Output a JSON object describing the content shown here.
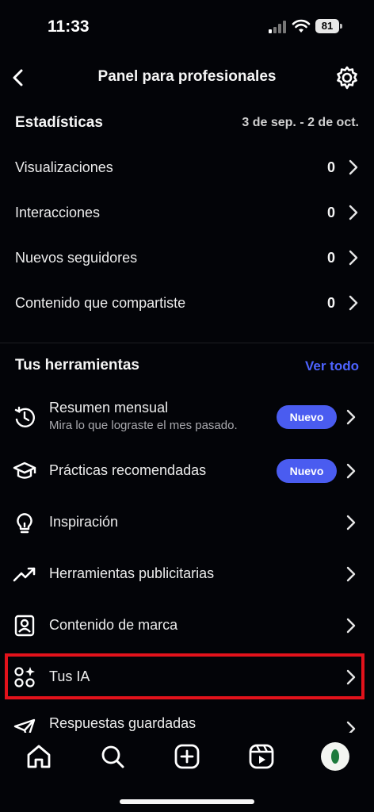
{
  "status_bar": {
    "time": "11:33",
    "battery": "81"
  },
  "header": {
    "title": "Panel para profesionales"
  },
  "stats": {
    "title": "Estadísticas",
    "date_range": "3 de sep. - 2 de oct.",
    "rows": [
      {
        "label": "Visualizaciones",
        "value": "0"
      },
      {
        "label": "Interacciones",
        "value": "0"
      },
      {
        "label": "Nuevos seguidores",
        "value": "0"
      },
      {
        "label": "Contenido que compartiste",
        "value": "0"
      }
    ]
  },
  "tools": {
    "title": "Tus herramientas",
    "see_all": "Ver todo",
    "items": [
      {
        "icon": "monthly-summary-icon",
        "label": "Resumen mensual",
        "sub": "Mira lo que lograste el mes pasado.",
        "badge": "Nuevo"
      },
      {
        "icon": "graduation-cap-icon",
        "label": "Prácticas recomendadas",
        "badge": "Nuevo"
      },
      {
        "icon": "lightbulb-icon",
        "label": "Inspiración"
      },
      {
        "icon": "trending-up-icon",
        "label": "Herramientas publicitarias"
      },
      {
        "icon": "branded-content-icon",
        "label": "Contenido de marca"
      },
      {
        "icon": "ai-icon",
        "label": "Tus IA"
      },
      {
        "icon": "paper-plane-icon",
        "label": "Respuestas guardadas"
      }
    ]
  },
  "bottom_nav": [
    "home-icon",
    "search-icon",
    "create-icon",
    "reels-icon",
    "profile-avatar"
  ],
  "colors": {
    "background": "#030408",
    "link": "#4d63ff",
    "badge": "#4a5cf0",
    "highlight": "#e3121b"
  }
}
